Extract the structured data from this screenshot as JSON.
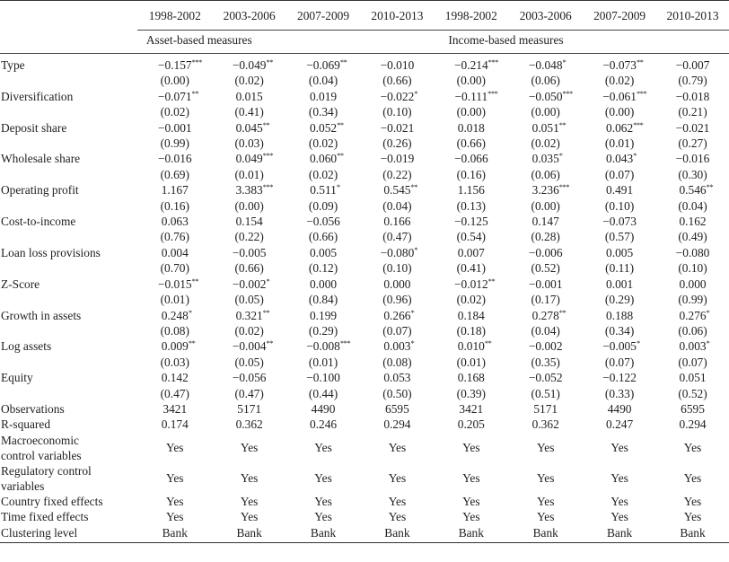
{
  "table": {
    "periods": [
      "1998-2002",
      "2003-2006",
      "2007-2009",
      "2010-2013",
      "1998-2002",
      "2003-2006",
      "2007-2009",
      "2010-2013"
    ],
    "groups": [
      {
        "label": "Asset-based measures"
      },
      {
        "label": "Income-based measures"
      }
    ],
    "rows": [
      {
        "label": "Type",
        "coef": [
          [
            "−0.157",
            "***"
          ],
          [
            "−0.049",
            "**"
          ],
          [
            "−0.069",
            "**"
          ],
          [
            "−0.010",
            ""
          ],
          [
            "−0.214",
            "***"
          ],
          [
            "−0.048",
            "*"
          ],
          [
            "−0.073",
            "**"
          ],
          [
            "−0.007",
            ""
          ]
        ],
        "p": [
          "(0.00)",
          "(0.02)",
          "(0.04)",
          "(0.66)",
          "(0.00)",
          "(0.06)",
          "(0.02)",
          "(0.79)"
        ]
      },
      {
        "label": "Diversification",
        "coef": [
          [
            "−0.071",
            "**"
          ],
          [
            "0.015",
            ""
          ],
          [
            "0.019",
            ""
          ],
          [
            "−0.022",
            "*"
          ],
          [
            "−0.111",
            "***"
          ],
          [
            "−0.050",
            "***"
          ],
          [
            "−0.061",
            "***"
          ],
          [
            "−0.018",
            ""
          ]
        ],
        "p": [
          "(0.02)",
          "(0.41)",
          "(0.34)",
          "(0.10)",
          "(0.00)",
          "(0.00)",
          "(0.00)",
          "(0.21)"
        ]
      },
      {
        "label": "Deposit share",
        "coef": [
          [
            "−0.001",
            ""
          ],
          [
            "0.045",
            "**"
          ],
          [
            "0.052",
            "**"
          ],
          [
            "−0.021",
            ""
          ],
          [
            "0.018",
            ""
          ],
          [
            "0.051",
            "**"
          ],
          [
            "0.062",
            "***"
          ],
          [
            "−0.021",
            ""
          ]
        ],
        "p": [
          "(0.99)",
          "(0.03)",
          "(0.02)",
          "(0.26)",
          "(0.66)",
          "(0.02)",
          "(0.01)",
          "(0.27)"
        ]
      },
      {
        "label": "Wholesale share",
        "coef": [
          [
            "−0.016",
            ""
          ],
          [
            "0.049",
            "***"
          ],
          [
            "0.060",
            "**"
          ],
          [
            "−0.019",
            ""
          ],
          [
            "−0.066",
            ""
          ],
          [
            "0.035",
            "*"
          ],
          [
            "0.043",
            "*"
          ],
          [
            "−0.016",
            ""
          ]
        ],
        "p": [
          "(0.69)",
          "(0.01)",
          "(0.02)",
          "(0.22)",
          "(0.16)",
          "(0.06)",
          "(0.07)",
          "(0.30)"
        ]
      },
      {
        "label": "Operating profit",
        "coef": [
          [
            "1.167",
            ""
          ],
          [
            "3.383",
            "***"
          ],
          [
            "0.511",
            "*"
          ],
          [
            "0.545",
            "**"
          ],
          [
            "1.156",
            ""
          ],
          [
            "3.236",
            "***"
          ],
          [
            "0.491",
            ""
          ],
          [
            "0.546",
            "**"
          ]
        ],
        "p": [
          "(0.16)",
          "(0.00)",
          "(0.09)",
          "(0.04)",
          "(0.13)",
          "(0.00)",
          "(0.10)",
          "(0.04)"
        ]
      },
      {
        "label": "Cost-to-income",
        "coef": [
          [
            "0.063",
            ""
          ],
          [
            "0.154",
            ""
          ],
          [
            "−0.056",
            ""
          ],
          [
            "0.166",
            ""
          ],
          [
            "−0.125",
            ""
          ],
          [
            "0.147",
            ""
          ],
          [
            "−0.073",
            ""
          ],
          [
            "0.162",
            ""
          ]
        ],
        "p": [
          "(0.76)",
          "(0.22)",
          "(0.66)",
          "(0.47)",
          "(0.54)",
          "(0.28)",
          "(0.57)",
          "(0.49)"
        ]
      },
      {
        "label": "Loan loss provisions",
        "coef": [
          [
            "0.004",
            ""
          ],
          [
            "−0.005",
            ""
          ],
          [
            "0.005",
            ""
          ],
          [
            "−0.080",
            "*"
          ],
          [
            "0.007",
            ""
          ],
          [
            "−0.006",
            ""
          ],
          [
            "0.005",
            ""
          ],
          [
            "−0.080",
            ""
          ]
        ],
        "p": [
          "(0.70)",
          "(0.66)",
          "(0.12)",
          "(0.10)",
          "(0.41)",
          "(0.52)",
          "(0.11)",
          "(0.10)"
        ]
      },
      {
        "label": "Z-Score",
        "coef": [
          [
            "−0.015",
            "**"
          ],
          [
            "−0.002",
            "*"
          ],
          [
            "0.000",
            ""
          ],
          [
            "0.000",
            ""
          ],
          [
            "−0.012",
            "**"
          ],
          [
            "−0.001",
            ""
          ],
          [
            "0.001",
            ""
          ],
          [
            "0.000",
            ""
          ]
        ],
        "p": [
          "(0.01)",
          "(0.05)",
          "(0.84)",
          "(0.96)",
          "(0.02)",
          "(0.17)",
          "(0.29)",
          "(0.99)"
        ]
      },
      {
        "label": "Growth in assets",
        "coef": [
          [
            "0.248",
            "*"
          ],
          [
            "0.321",
            "**"
          ],
          [
            "0.199",
            ""
          ],
          [
            "0.266",
            "*"
          ],
          [
            "0.184",
            ""
          ],
          [
            "0.278",
            "**"
          ],
          [
            "0.188",
            ""
          ],
          [
            "0.276",
            "*"
          ]
        ],
        "p": [
          "(0.08)",
          "(0.02)",
          "(0.29)",
          "(0.07)",
          "(0.18)",
          "(0.04)",
          "(0.34)",
          "(0.06)"
        ]
      },
      {
        "label": "Log assets",
        "coef": [
          [
            "0.009",
            "**"
          ],
          [
            "−0.004",
            "**"
          ],
          [
            "−0.008",
            "***"
          ],
          [
            "0.003",
            "*"
          ],
          [
            "0.010",
            "**"
          ],
          [
            "−0.002",
            ""
          ],
          [
            "−0.005",
            "*"
          ],
          [
            "0.003",
            "*"
          ]
        ],
        "p": [
          "(0.03)",
          "(0.05)",
          "(0.01)",
          "(0.08)",
          "(0.01)",
          "(0.35)",
          "(0.07)",
          "(0.07)"
        ]
      },
      {
        "label": "Equity",
        "coef": [
          [
            "0.142",
            ""
          ],
          [
            "−0.056",
            ""
          ],
          [
            "−0.100",
            ""
          ],
          [
            "0.053",
            ""
          ],
          [
            "0.168",
            ""
          ],
          [
            "−0.052",
            ""
          ],
          [
            "−0.122",
            ""
          ],
          [
            "0.051",
            ""
          ]
        ],
        "p": [
          "(0.47)",
          "(0.47)",
          "(0.44)",
          "(0.50)",
          "(0.39)",
          "(0.51)",
          "(0.33)",
          "(0.52)"
        ]
      }
    ],
    "stats": [
      {
        "label": "Observations",
        "values": [
          "3421",
          "5171",
          "4490",
          "6595",
          "3421",
          "5171",
          "4490",
          "6595"
        ]
      },
      {
        "label": "R-squared",
        "values": [
          "0.174",
          "0.362",
          "0.246",
          "0.294",
          "0.205",
          "0.362",
          "0.247",
          "0.294"
        ]
      },
      {
        "label": "Macroeconomic control variables",
        "label_lines": [
          "Macroeconomic",
          "control variables"
        ],
        "values": [
          "Yes",
          "Yes",
          "Yes",
          "Yes",
          "Yes",
          "Yes",
          "Yes",
          "Yes"
        ]
      },
      {
        "label": "Regulatory control variables",
        "label_lines": [
          "Regulatory control",
          "variables"
        ],
        "values": [
          "Yes",
          "Yes",
          "Yes",
          "Yes",
          "Yes",
          "Yes",
          "Yes",
          "Yes"
        ]
      },
      {
        "label": "Country fixed effects",
        "values": [
          "Yes",
          "Yes",
          "Yes",
          "Yes",
          "Yes",
          "Yes",
          "Yes",
          "Yes"
        ]
      },
      {
        "label": "Time fixed effects",
        "values": [
          "Yes",
          "Yes",
          "Yes",
          "Yes",
          "Yes",
          "Yes",
          "Yes",
          "Yes"
        ]
      },
      {
        "label": "Clustering level",
        "values": [
          "Bank",
          "Bank",
          "Bank",
          "Bank",
          "Bank",
          "Bank",
          "Bank",
          "Bank"
        ]
      }
    ]
  }
}
